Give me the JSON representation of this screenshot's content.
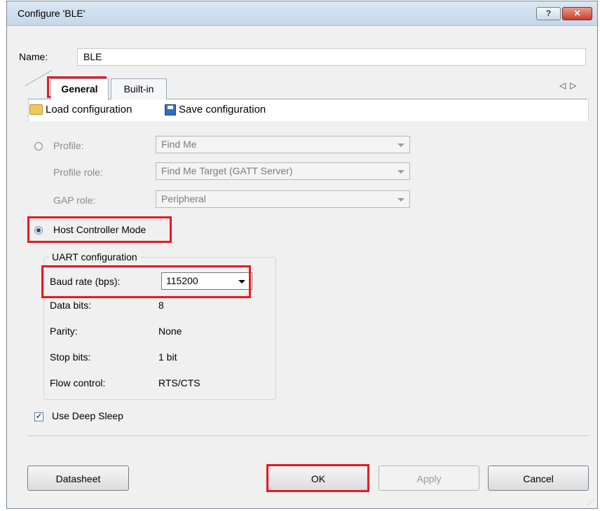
{
  "window": {
    "title": "Configure 'BLE'",
    "help_glyph": "?",
    "close_glyph": "✕"
  },
  "name_field": {
    "label": "Name:",
    "value": "BLE"
  },
  "tabs": [
    {
      "label": "General"
    },
    {
      "label": "Built-in"
    }
  ],
  "tab_scroll": {
    "left": "◁",
    "right": "▷"
  },
  "toolbar": {
    "load_label": "Load configuration",
    "save_label": "Save configuration"
  },
  "profile_section": {
    "profile_label": "Profile:",
    "profile_value": "Find Me",
    "role_label": "Profile role:",
    "role_value": "Find Me Target (GATT Server)",
    "gap_label": "GAP role:",
    "gap_value": "Peripheral"
  },
  "hcm": {
    "label": "Host Controller Mode"
  },
  "uart": {
    "title": "UART configuration",
    "baud_label": "Baud rate (bps):",
    "baud_value": "115200",
    "data_bits_label": "Data bits:",
    "data_bits_value": "8",
    "parity_label": "Parity:",
    "parity_value": "None",
    "stop_bits_label": "Stop bits:",
    "stop_bits_value": "1 bit",
    "flow_label": "Flow control:",
    "flow_value": "RTS/CTS"
  },
  "deep_sleep": {
    "label": "Use Deep Sleep",
    "check": "✓"
  },
  "buttons": {
    "datasheet": "Datasheet",
    "ok": "OK",
    "apply": "Apply",
    "cancel": "Cancel"
  },
  "colors": {
    "highlight": "#e31b23"
  }
}
